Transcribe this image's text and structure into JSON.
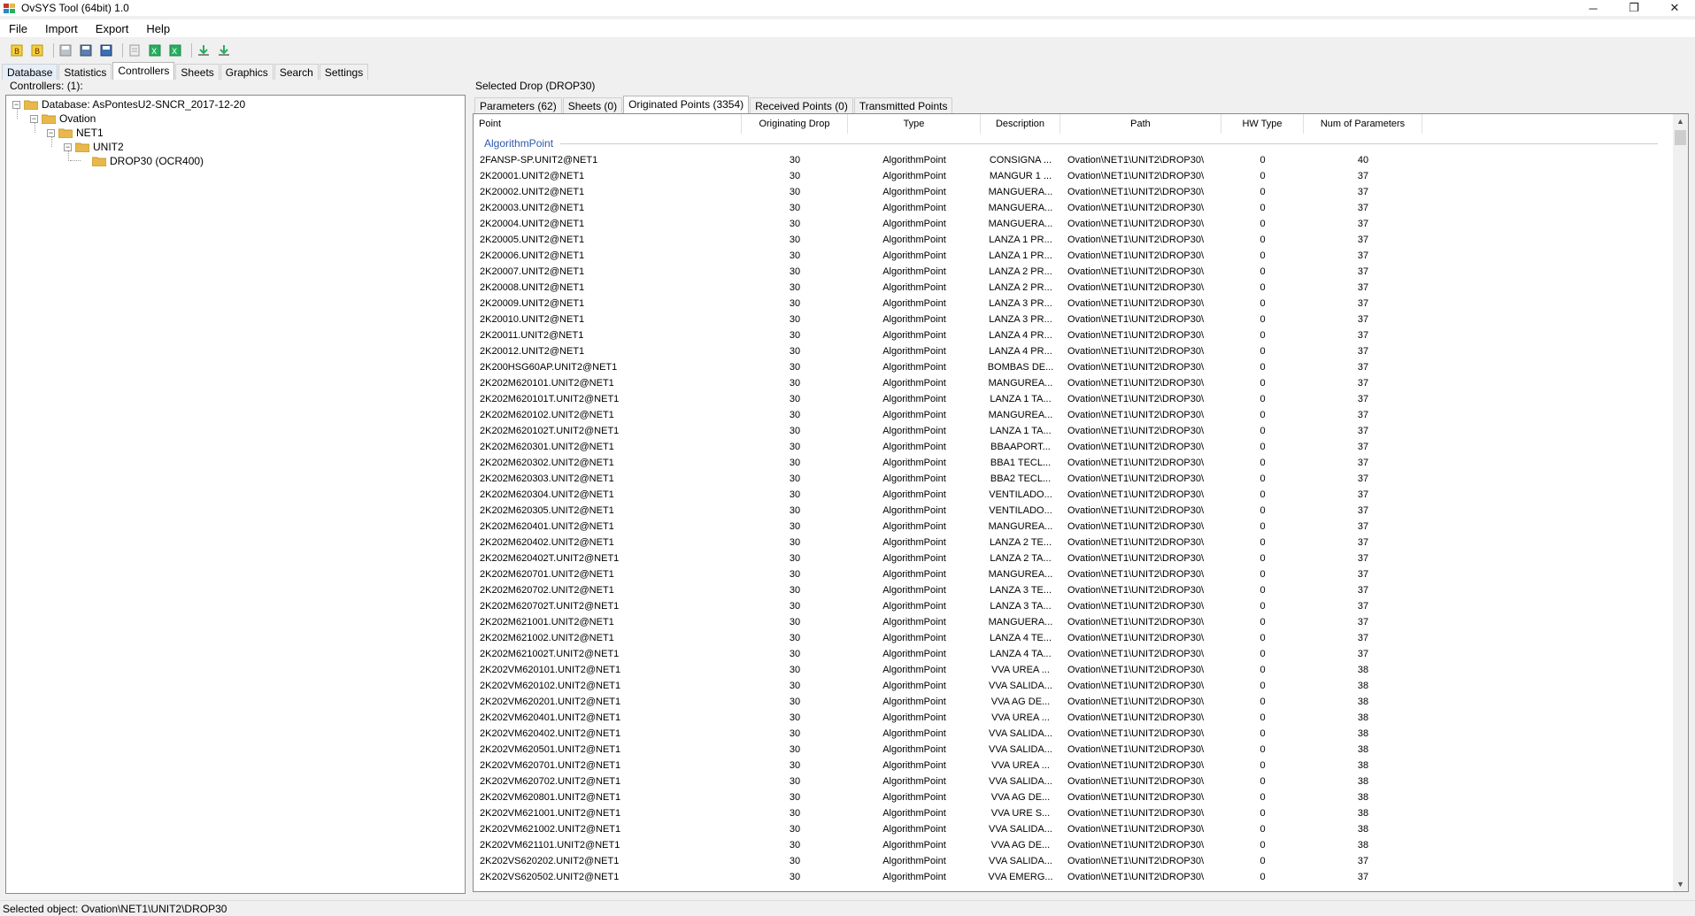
{
  "window": {
    "title": "OvSYS Tool (64bit) 1.0"
  },
  "menu": [
    "File",
    "Import",
    "Export",
    "Help"
  ],
  "toolbar_icons": [
    "import-b-icon",
    "import-b2-icon",
    "save-icon",
    "save-as-icon",
    "save-all-icon",
    "page-icon",
    "export-excel-icon",
    "export-excel2-icon",
    "download-icon",
    "download2-icon"
  ],
  "tabs": [
    "Database",
    "Statistics",
    "Controllers",
    "Sheets",
    "Graphics",
    "Search",
    "Settings"
  ],
  "active_tab": "Controllers",
  "left": {
    "label": "Controllers: (1):",
    "tree": [
      {
        "label": "Database: AsPontesU2-SNCR_2017-12-20",
        "level": 0
      },
      {
        "label": "Ovation",
        "level": 1
      },
      {
        "label": "NET1",
        "level": 2
      },
      {
        "label": "UNIT2",
        "level": 3
      },
      {
        "label": "DROP30 (OCR400)",
        "level": 4
      }
    ]
  },
  "right": {
    "label": "Selected Drop (DROP30)",
    "tabs": [
      "Parameters (62)",
      "Sheets (0)",
      "Originated Points (3354)",
      "Received Points (0)",
      "Transmitted Points"
    ],
    "active_tab": "Originated Points (3354)",
    "columns": [
      "Point",
      "Originating Drop",
      "Type",
      "Description",
      "Path",
      "HW Type",
      "Num of Parameters"
    ],
    "group": "AlgorithmPoint",
    "rows": [
      [
        "2FANSP-SP.UNIT2@NET1",
        "30",
        "AlgorithmPoint",
        "CONSIGNA ...",
        "Ovation\\NET1\\UNIT2\\DROP30\\",
        "0",
        "40"
      ],
      [
        "2K20001.UNIT2@NET1",
        "30",
        "AlgorithmPoint",
        "MANGUR 1 ...",
        "Ovation\\NET1\\UNIT2\\DROP30\\",
        "0",
        "37"
      ],
      [
        "2K20002.UNIT2@NET1",
        "30",
        "AlgorithmPoint",
        "MANGUERA...",
        "Ovation\\NET1\\UNIT2\\DROP30\\",
        "0",
        "37"
      ],
      [
        "2K20003.UNIT2@NET1",
        "30",
        "AlgorithmPoint",
        "MANGUERA...",
        "Ovation\\NET1\\UNIT2\\DROP30\\",
        "0",
        "37"
      ],
      [
        "2K20004.UNIT2@NET1",
        "30",
        "AlgorithmPoint",
        "MANGUERA...",
        "Ovation\\NET1\\UNIT2\\DROP30\\",
        "0",
        "37"
      ],
      [
        "2K20005.UNIT2@NET1",
        "30",
        "AlgorithmPoint",
        "LANZA 1 PR...",
        "Ovation\\NET1\\UNIT2\\DROP30\\",
        "0",
        "37"
      ],
      [
        "2K20006.UNIT2@NET1",
        "30",
        "AlgorithmPoint",
        "LANZA 1 PR...",
        "Ovation\\NET1\\UNIT2\\DROP30\\",
        "0",
        "37"
      ],
      [
        "2K20007.UNIT2@NET1",
        "30",
        "AlgorithmPoint",
        "LANZA 2 PR...",
        "Ovation\\NET1\\UNIT2\\DROP30\\",
        "0",
        "37"
      ],
      [
        "2K20008.UNIT2@NET1",
        "30",
        "AlgorithmPoint",
        "LANZA 2 PR...",
        "Ovation\\NET1\\UNIT2\\DROP30\\",
        "0",
        "37"
      ],
      [
        "2K20009.UNIT2@NET1",
        "30",
        "AlgorithmPoint",
        "LANZA 3 PR...",
        "Ovation\\NET1\\UNIT2\\DROP30\\",
        "0",
        "37"
      ],
      [
        "2K20010.UNIT2@NET1",
        "30",
        "AlgorithmPoint",
        "LANZA 3 PR...",
        "Ovation\\NET1\\UNIT2\\DROP30\\",
        "0",
        "37"
      ],
      [
        "2K20011.UNIT2@NET1",
        "30",
        "AlgorithmPoint",
        "LANZA 4 PR...",
        "Ovation\\NET1\\UNIT2\\DROP30\\",
        "0",
        "37"
      ],
      [
        "2K20012.UNIT2@NET1",
        "30",
        "AlgorithmPoint",
        "LANZA 4 PR...",
        "Ovation\\NET1\\UNIT2\\DROP30\\",
        "0",
        "37"
      ],
      [
        "2K200HSG60AP.UNIT2@NET1",
        "30",
        "AlgorithmPoint",
        "BOMBAS DE...",
        "Ovation\\NET1\\UNIT2\\DROP30\\",
        "0",
        "37"
      ],
      [
        "2K202M620101.UNIT2@NET1",
        "30",
        "AlgorithmPoint",
        "MANGUREA...",
        "Ovation\\NET1\\UNIT2\\DROP30\\",
        "0",
        "37"
      ],
      [
        "2K202M620101T.UNIT2@NET1",
        "30",
        "AlgorithmPoint",
        "LANZA 1 TA...",
        "Ovation\\NET1\\UNIT2\\DROP30\\",
        "0",
        "37"
      ],
      [
        "2K202M620102.UNIT2@NET1",
        "30",
        "AlgorithmPoint",
        "MANGUREA...",
        "Ovation\\NET1\\UNIT2\\DROP30\\",
        "0",
        "37"
      ],
      [
        "2K202M620102T.UNIT2@NET1",
        "30",
        "AlgorithmPoint",
        "LANZA 1 TA...",
        "Ovation\\NET1\\UNIT2\\DROP30\\",
        "0",
        "37"
      ],
      [
        "2K202M620301.UNIT2@NET1",
        "30",
        "AlgorithmPoint",
        "BBAAPORT...",
        "Ovation\\NET1\\UNIT2\\DROP30\\",
        "0",
        "37"
      ],
      [
        "2K202M620302.UNIT2@NET1",
        "30",
        "AlgorithmPoint",
        "BBA1 TECL...",
        "Ovation\\NET1\\UNIT2\\DROP30\\",
        "0",
        "37"
      ],
      [
        "2K202M620303.UNIT2@NET1",
        "30",
        "AlgorithmPoint",
        "BBA2 TECL...",
        "Ovation\\NET1\\UNIT2\\DROP30\\",
        "0",
        "37"
      ],
      [
        "2K202M620304.UNIT2@NET1",
        "30",
        "AlgorithmPoint",
        "VENTILADO...",
        "Ovation\\NET1\\UNIT2\\DROP30\\",
        "0",
        "37"
      ],
      [
        "2K202M620305.UNIT2@NET1",
        "30",
        "AlgorithmPoint",
        "VENTILADO...",
        "Ovation\\NET1\\UNIT2\\DROP30\\",
        "0",
        "37"
      ],
      [
        "2K202M620401.UNIT2@NET1",
        "30",
        "AlgorithmPoint",
        "MANGUREA...",
        "Ovation\\NET1\\UNIT2\\DROP30\\",
        "0",
        "37"
      ],
      [
        "2K202M620402.UNIT2@NET1",
        "30",
        "AlgorithmPoint",
        "LANZA 2 TE...",
        "Ovation\\NET1\\UNIT2\\DROP30\\",
        "0",
        "37"
      ],
      [
        "2K202M620402T.UNIT2@NET1",
        "30",
        "AlgorithmPoint",
        "LANZA 2 TA...",
        "Ovation\\NET1\\UNIT2\\DROP30\\",
        "0",
        "37"
      ],
      [
        "2K202M620701.UNIT2@NET1",
        "30",
        "AlgorithmPoint",
        "MANGUREA...",
        "Ovation\\NET1\\UNIT2\\DROP30\\",
        "0",
        "37"
      ],
      [
        "2K202M620702.UNIT2@NET1",
        "30",
        "AlgorithmPoint",
        "LANZA 3 TE...",
        "Ovation\\NET1\\UNIT2\\DROP30\\",
        "0",
        "37"
      ],
      [
        "2K202M620702T.UNIT2@NET1",
        "30",
        "AlgorithmPoint",
        "LANZA 3 TA...",
        "Ovation\\NET1\\UNIT2\\DROP30\\",
        "0",
        "37"
      ],
      [
        "2K202M621001.UNIT2@NET1",
        "30",
        "AlgorithmPoint",
        "MANGUERA...",
        "Ovation\\NET1\\UNIT2\\DROP30\\",
        "0",
        "37"
      ],
      [
        "2K202M621002.UNIT2@NET1",
        "30",
        "AlgorithmPoint",
        "LANZA 4 TE...",
        "Ovation\\NET1\\UNIT2\\DROP30\\",
        "0",
        "37"
      ],
      [
        "2K202M621002T.UNIT2@NET1",
        "30",
        "AlgorithmPoint",
        "LANZA 4 TA...",
        "Ovation\\NET1\\UNIT2\\DROP30\\",
        "0",
        "37"
      ],
      [
        "2K202VM620101.UNIT2@NET1",
        "30",
        "AlgorithmPoint",
        "VVA UREA ...",
        "Ovation\\NET1\\UNIT2\\DROP30\\",
        "0",
        "38"
      ],
      [
        "2K202VM620102.UNIT2@NET1",
        "30",
        "AlgorithmPoint",
        "VVA SALIDA...",
        "Ovation\\NET1\\UNIT2\\DROP30\\",
        "0",
        "38"
      ],
      [
        "2K202VM620201.UNIT2@NET1",
        "30",
        "AlgorithmPoint",
        "VVA AG DE...",
        "Ovation\\NET1\\UNIT2\\DROP30\\",
        "0",
        "38"
      ],
      [
        "2K202VM620401.UNIT2@NET1",
        "30",
        "AlgorithmPoint",
        "VVA UREA ...",
        "Ovation\\NET1\\UNIT2\\DROP30\\",
        "0",
        "38"
      ],
      [
        "2K202VM620402.UNIT2@NET1",
        "30",
        "AlgorithmPoint",
        "VVA SALIDA...",
        "Ovation\\NET1\\UNIT2\\DROP30\\",
        "0",
        "38"
      ],
      [
        "2K202VM620501.UNIT2@NET1",
        "30",
        "AlgorithmPoint",
        "VVA SALIDA...",
        "Ovation\\NET1\\UNIT2\\DROP30\\",
        "0",
        "38"
      ],
      [
        "2K202VM620701.UNIT2@NET1",
        "30",
        "AlgorithmPoint",
        "VVA UREA ...",
        "Ovation\\NET1\\UNIT2\\DROP30\\",
        "0",
        "38"
      ],
      [
        "2K202VM620702.UNIT2@NET1",
        "30",
        "AlgorithmPoint",
        "VVA SALIDA...",
        "Ovation\\NET1\\UNIT2\\DROP30\\",
        "0",
        "38"
      ],
      [
        "2K202VM620801.UNIT2@NET1",
        "30",
        "AlgorithmPoint",
        "VVA AG DE...",
        "Ovation\\NET1\\UNIT2\\DROP30\\",
        "0",
        "38"
      ],
      [
        "2K202VM621001.UNIT2@NET1",
        "30",
        "AlgorithmPoint",
        "VVA URE S...",
        "Ovation\\NET1\\UNIT2\\DROP30\\",
        "0",
        "38"
      ],
      [
        "2K202VM621002.UNIT2@NET1",
        "30",
        "AlgorithmPoint",
        "VVA SALIDA...",
        "Ovation\\NET1\\UNIT2\\DROP30\\",
        "0",
        "38"
      ],
      [
        "2K202VM621101.UNIT2@NET1",
        "30",
        "AlgorithmPoint",
        "VVA AG DE...",
        "Ovation\\NET1\\UNIT2\\DROP30\\",
        "0",
        "38"
      ],
      [
        "2K202VS620202.UNIT2@NET1",
        "30",
        "AlgorithmPoint",
        "VVA SALIDA...",
        "Ovation\\NET1\\UNIT2\\DROP30\\",
        "0",
        "37"
      ],
      [
        "2K202VS620502.UNIT2@NET1",
        "30",
        "AlgorithmPoint",
        "VVA EMERG...",
        "Ovation\\NET1\\UNIT2\\DROP30\\",
        "0",
        "37"
      ]
    ]
  },
  "status": "Selected object: Ovation\\NET1\\UNIT2\\DROP30",
  "colors": {
    "group": "#2d5aa8",
    "folder": "#e8b84a"
  }
}
